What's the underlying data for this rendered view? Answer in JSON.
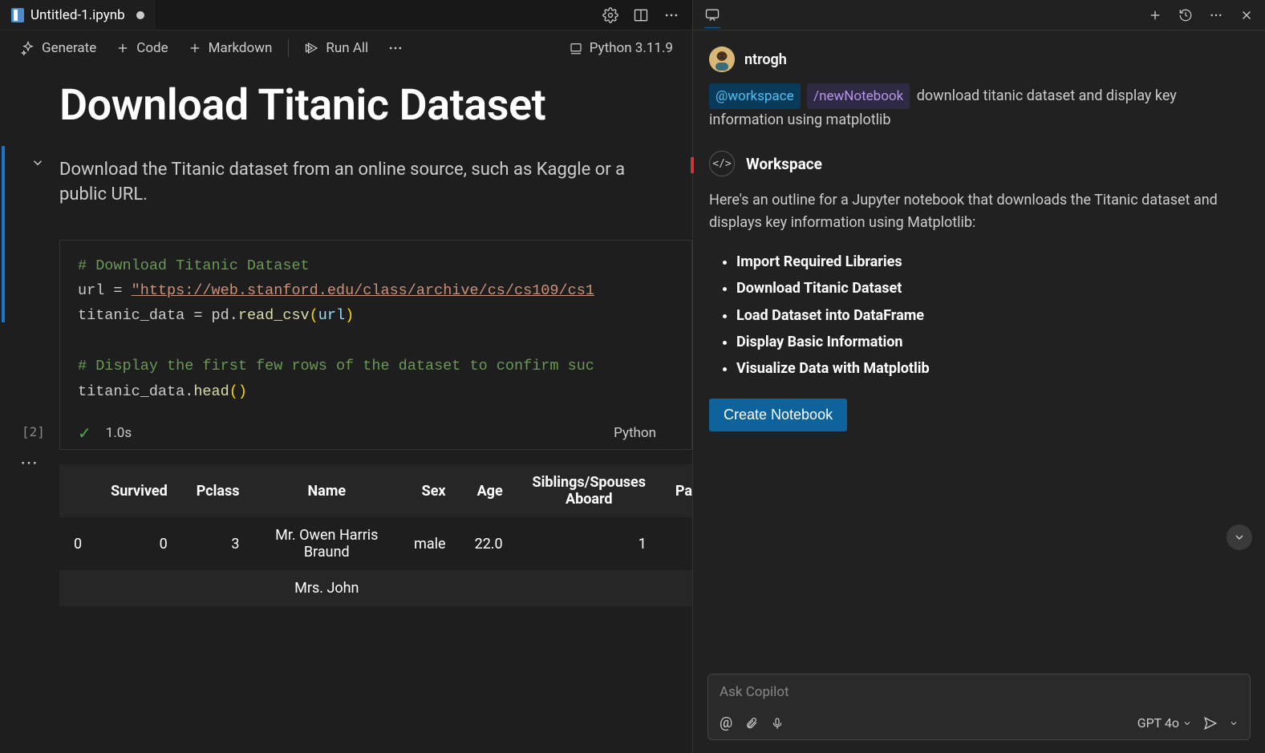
{
  "tab": {
    "name": "Untitled-1.ipynb"
  },
  "toolbar": {
    "generate": "Generate",
    "code": "Code",
    "markdown": "Markdown",
    "run_all": "Run All",
    "kernel": "Python 3.11.9"
  },
  "notebook": {
    "h1": "Download Titanic Dataset",
    "desc": "Download the Titanic dataset from an online source, such as Kaggle or a public URL.",
    "code": {
      "c1": "# Download Titanic Dataset",
      "l2a": "url = ",
      "l2b": "\"https://web.stanford.edu/class/archive/cs/cs109/cs1",
      "l3a": "titanic_data = pd.",
      "l3b": "read_csv",
      "l3c": "(",
      "l3d": "url",
      "l3e": ")",
      "c2": "# Display the first few rows of the dataset to confirm suc",
      "l5a": "titanic_data.",
      "l5b": "head",
      "l5c": "()"
    },
    "exec": {
      "count": "[2]",
      "time": "1.0s",
      "lang": "Python"
    },
    "table": {
      "headers": [
        "",
        "Survived",
        "Pclass",
        "Name",
        "Sex",
        "Age",
        "Siblings/Spouses Aboard",
        "Pa"
      ],
      "row0": {
        "idx": "0",
        "survived": "0",
        "pclass": "3",
        "name": "Mr. Owen Harris Braund",
        "sex": "male",
        "age": "22.0",
        "sib": "1"
      },
      "row1": {
        "name": "Mrs. John"
      }
    }
  },
  "chat": {
    "user": "ntrogh",
    "chip_workspace": "@workspace",
    "chip_new": "/newNotebook",
    "prompt_rest": "download titanic dataset and display key information using matplotlib",
    "agent_name": "Workspace",
    "agent_intro": "Here's an outline for a Jupyter notebook that downloads the Titanic dataset and displays key information using Matplotlib:",
    "outline": [
      "Import Required Libraries",
      "Download Titanic Dataset",
      "Load Dataset into DataFrame",
      "Display Basic Information",
      "Visualize Data with Matplotlib"
    ],
    "create_btn": "Create Notebook",
    "input_placeholder": "Ask Copilot",
    "model": "GPT 4o"
  }
}
